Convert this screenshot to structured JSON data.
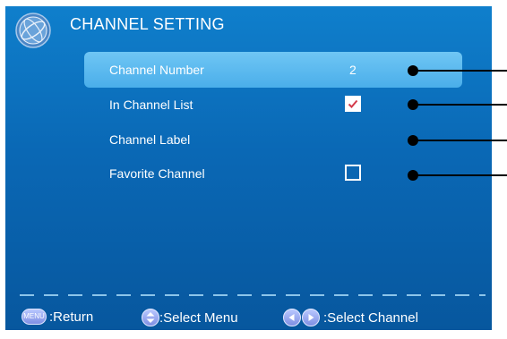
{
  "header": {
    "title": "CHANNEL SETTING",
    "logo_icon": "globe-logo-icon"
  },
  "menu": {
    "items": [
      {
        "label": "Channel Number",
        "value": "2",
        "selected": true
      },
      {
        "label": "In Channel List",
        "checked": true
      },
      {
        "label": "Channel Label"
      },
      {
        "label": "Favorite Channel",
        "checked": false
      }
    ]
  },
  "footer": {
    "menu_key_label": "MENU",
    "return_label": ":Return",
    "select_menu_label": ":Select Menu",
    "select_channel_label": ":Select Channel"
  },
  "colors": {
    "screen_bg": "#0a68b5",
    "selected_bg": "#5bb9ef",
    "check_color": "#d43b4a"
  }
}
